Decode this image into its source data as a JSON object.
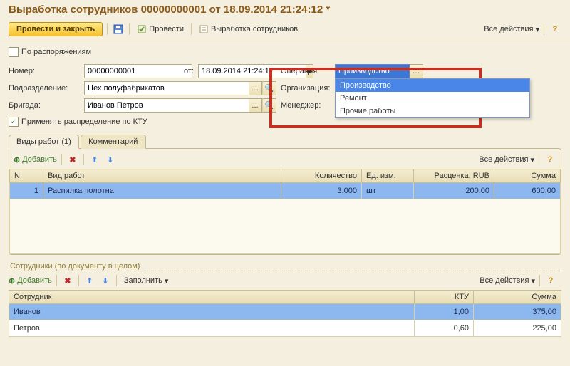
{
  "title": "Выработка сотрудников 00000000001 от 18.09.2014 21:24:12 *",
  "toolbar": {
    "post_and_close": "Провести и закрыть",
    "post": "Провести",
    "emp_output": "Выработка сотрудников",
    "all_actions": "Все действия"
  },
  "by_orders": {
    "label": "По распоряжениям",
    "checked": false
  },
  "form": {
    "number_label": "Номер:",
    "number": "00000000001",
    "from_label": "от:",
    "date": "18.09.2014 21:24:12",
    "subdivision_label": "Подразделение:",
    "subdivision": "Цех полуфабрикатов",
    "org_label": "Организация:",
    "brigade_label": "Бригада:",
    "brigade": "Иванов Петров",
    "manager_label": "Менеджер:",
    "operation_label": "Операция:",
    "operation": "Производство",
    "operation_options": [
      "Производство",
      "Ремонт",
      "Прочие работы"
    ]
  },
  "ktu": {
    "label": "Применять распределение по КТУ",
    "checked": true
  },
  "tabs": {
    "works": "Виды работ (1)",
    "comment": "Комментарий"
  },
  "works": {
    "add": "Добавить",
    "all_actions": "Все действия",
    "cols": {
      "n": "N",
      "type": "Вид работ",
      "qty": "Количество",
      "unit": "Ед. изм.",
      "price": "Расценка, RUB",
      "sum": "Сумма"
    },
    "rows": [
      {
        "n": "1",
        "type": "Распилка полотна",
        "qty": "3,000",
        "unit": "шт",
        "price": "200,00",
        "sum": "600,00"
      }
    ]
  },
  "employees_section": "Сотрудники (по документу в целом)",
  "employees": {
    "add": "Добавить",
    "fill": "Заполнить",
    "all_actions": "Все действия",
    "cols": {
      "emp": "Сотрудник",
      "ktu": "КТУ",
      "sum": "Сумма"
    },
    "rows": [
      {
        "emp": "Иванов",
        "ktu": "1,00",
        "sum": "375,00"
      },
      {
        "emp": "Петров",
        "ktu": "0,60",
        "sum": "225,00"
      }
    ]
  }
}
